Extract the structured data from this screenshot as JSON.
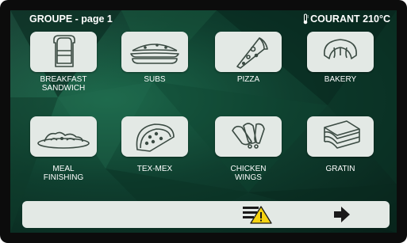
{
  "header": {
    "title": "GROUPE - page 1",
    "temperature": "COURANT 210°C",
    "thermometer_icon": "thermometer-icon"
  },
  "tiles": [
    {
      "label": "BREAKFAST\nSANDWICH",
      "icon": "sandwich-icon"
    },
    {
      "label": "SUBS",
      "icon": "sub-sandwich-icon"
    },
    {
      "label": "PIZZA",
      "icon": "pizza-slice-icon"
    },
    {
      "label": "BAKERY",
      "icon": "croissant-icon"
    },
    {
      "label": "MEAL\nFINISHING",
      "icon": "plated-meal-icon"
    },
    {
      "label": "TEX-MEX",
      "icon": "taco-icon"
    },
    {
      "label": "CHICKEN\nWINGS",
      "icon": "chicken-wings-icon"
    },
    {
      "label": "GRATIN",
      "icon": "gratin-layers-icon"
    }
  ],
  "bottom_bar": {
    "warning_icon": "list-warning-icon",
    "next_icon": "arrow-right-icon"
  },
  "colors": {
    "tile_bg": "#e3e9e5",
    "icon_stroke": "#3a4a42",
    "warning_yellow": "#f5d311",
    "text": "#ffffff"
  }
}
